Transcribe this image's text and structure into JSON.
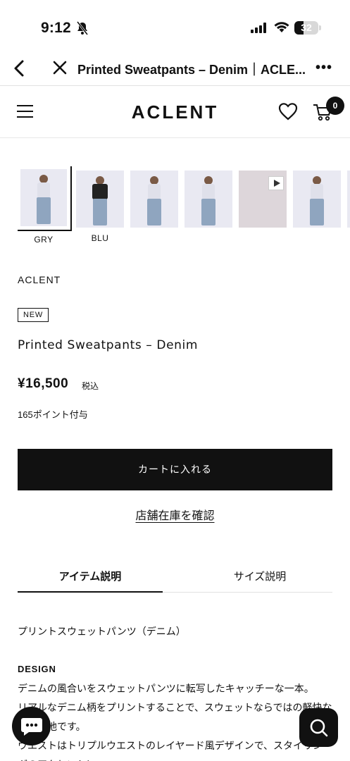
{
  "status_bar": {
    "time": "9:12",
    "battery": "32"
  },
  "browser": {
    "title": "Printed Sweatpants – Denim｜ACLE...",
    "more": "•••"
  },
  "header": {
    "logo": "ACLENT",
    "cart_count": "0"
  },
  "thumbnails": [
    {
      "label": "GRY",
      "selected": true,
      "top": "light"
    },
    {
      "label": "BLU",
      "selected": false,
      "top": "dark"
    },
    {
      "label": "",
      "selected": false,
      "top": "light"
    },
    {
      "label": "",
      "selected": false,
      "top": "light"
    },
    {
      "label": "",
      "selected": false,
      "video": true
    },
    {
      "label": "",
      "selected": false,
      "top": "light"
    }
  ],
  "product": {
    "brand": "ACLENT",
    "badge": "NEW",
    "name": "Printed Sweatpants – Denim",
    "price": "¥16,500",
    "tax": "税込",
    "points": "165ポイント付与",
    "add_to_cart": "カートに入れる",
    "store_stock": "店舗在庫を確認"
  },
  "tabs": [
    {
      "label": "アイテム説明",
      "active": true
    },
    {
      "label": "サイズ説明",
      "active": false
    }
  ],
  "description": {
    "title": "プリントスウェットパンツ（デニム）",
    "subheading": "DESIGN",
    "lines": [
      "デニムの風合いをスウェットパンツに転写したキャッチーな一本。",
      "リアルなデニム柄をプリントすることで、スウェットならではの軽快な穿き心地です。",
      "ウエストはトリプルウエストのレイヤード風デザインで、スタイリングのアクセントに。"
    ]
  }
}
